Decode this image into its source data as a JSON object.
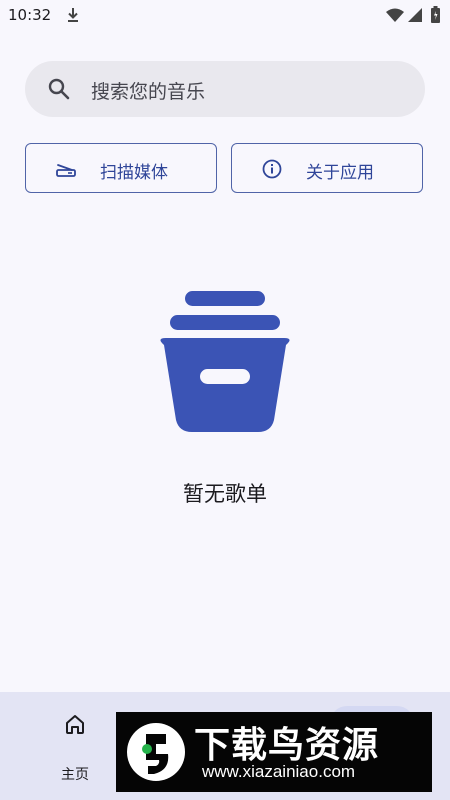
{
  "status_bar": {
    "time": "10:32",
    "icons": [
      "download-icon",
      "wifi-icon",
      "signal-icon",
      "battery-icon"
    ]
  },
  "search": {
    "placeholder": "搜索您的音乐",
    "icon": "search-icon"
  },
  "actions": {
    "scan_label": "扫描媒体",
    "scan_icon": "scanner-icon",
    "about_label": "关于应用",
    "about_icon": "info-icon"
  },
  "empty_state": {
    "icon": "archive-box-icon",
    "text": "暂无歌单"
  },
  "bottom_nav": {
    "items": [
      {
        "label": "主页",
        "icon": "home-icon"
      }
    ]
  },
  "watermark": {
    "title": "下载鸟资源",
    "url": "www.xiazainiao.com"
  },
  "colors": {
    "background": "#f8f7fd",
    "accent": "#3b54b5",
    "outline": "#5064a8",
    "search_bg": "#e9e8ee",
    "nav_bg": "#e3e4f4"
  }
}
